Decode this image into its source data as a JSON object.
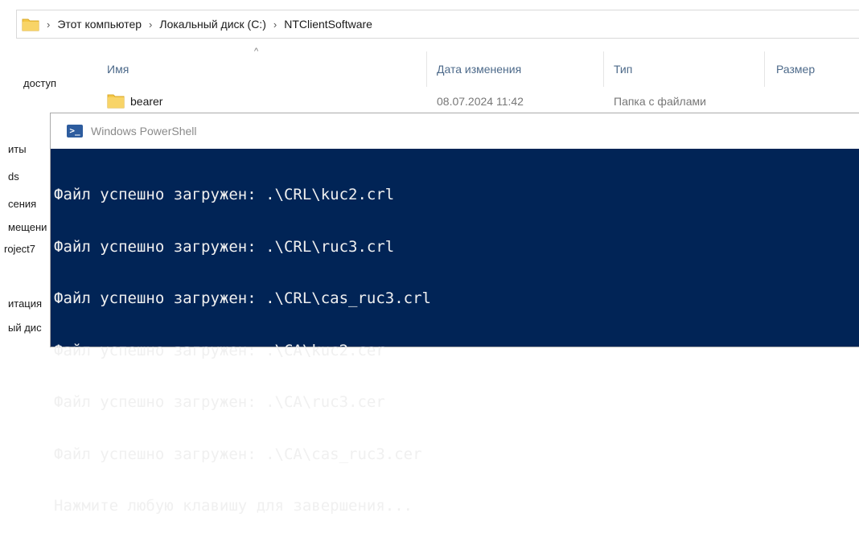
{
  "address_bar": {
    "crumbs": [
      "Этот компьютер",
      "Локальный диск (C:)",
      "NTClientSoftware"
    ],
    "separator": "›"
  },
  "nav_pane": {
    "items": [
      "доступ",
      "иты",
      "ds",
      "сения",
      "мещени",
      "roject7",
      "итация",
      "ый дис"
    ]
  },
  "columns": {
    "name": "Имя",
    "date": "Дата изменения",
    "type": "Тип",
    "size": "Размер",
    "sort_indicator": "^"
  },
  "file_rows": [
    {
      "name": "bearer",
      "date": "08.07.2024 11:42",
      "type": "Папка с файлами"
    }
  ],
  "powershell": {
    "title": "Windows PowerShell",
    "icon_glyph": ">_",
    "lines": [
      "Файл успешно загружен: .\\CRL\\kuc2.crl",
      "Файл успешно загружен: .\\CRL\\ruc3.crl",
      "Файл успешно загружен: .\\CRL\\cas_ruc3.crl",
      "Файл успешно загружен: .\\CA\\kuc2.cer",
      "Файл успешно загружен: .\\CA\\ruc3.cer",
      "Файл успешно загружен: .\\CA\\cas_ruc3.cer",
      "Нажмите любую клавишу для завершения..."
    ]
  },
  "colors": {
    "console_bg": "#012456",
    "console_text": "#f0f0f0",
    "folder_yellow": "#f5c847",
    "header_text": "#4d6a8a"
  },
  "icons": [
    "folder-icon",
    "powershell-icon"
  ]
}
